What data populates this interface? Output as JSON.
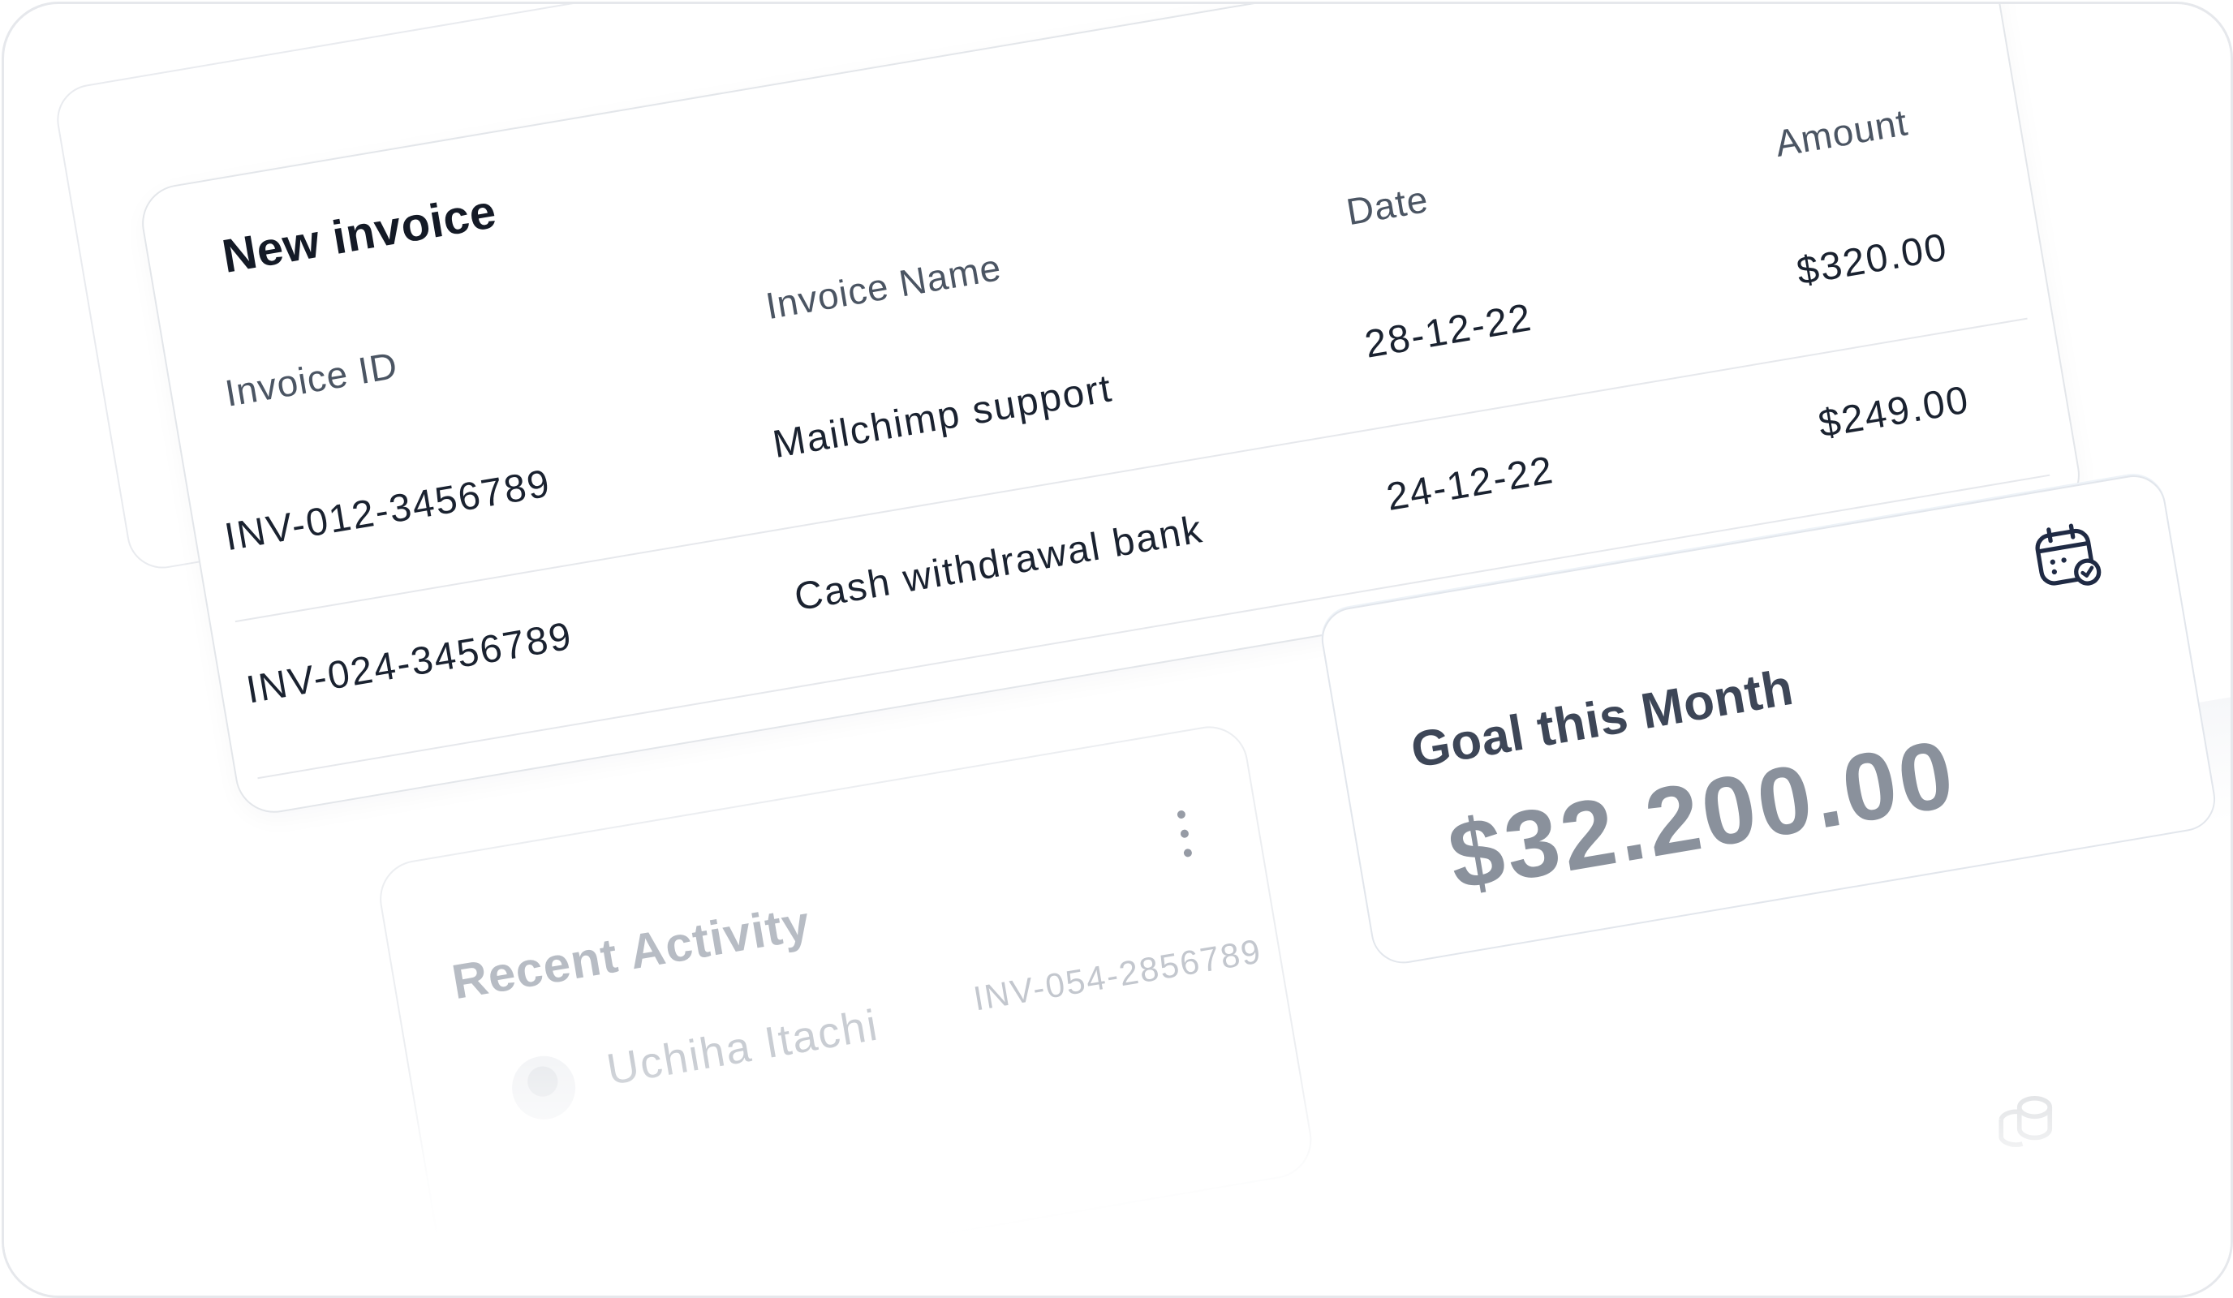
{
  "invoice": {
    "title": "New invoice",
    "columns": [
      "Invoice ID",
      "Invoice Name",
      "Date",
      "Amount"
    ],
    "rows": [
      {
        "id": "INV-012-3456789",
        "name": "Mailchimp support",
        "date": "28-12-22",
        "amount": "$320.00"
      },
      {
        "id": "INV-024-3456789",
        "name": "Cash withdrawal bank",
        "date": "24-12-22",
        "amount": "$249.00"
      }
    ]
  },
  "activity": {
    "title": "Recent Activity",
    "items": [
      {
        "name": "Uchiha Itachi",
        "invoice_id": "INV-054-2856789"
      }
    ]
  },
  "goal": {
    "title": "Goal this Month",
    "value": "$32.200.00",
    "icon": "calendar-check-icon"
  },
  "colors": {
    "text_dark": "#141a26",
    "text_muted": "#4b5563",
    "border": "#e3e6ea",
    "goal_value": "#8a919c"
  }
}
